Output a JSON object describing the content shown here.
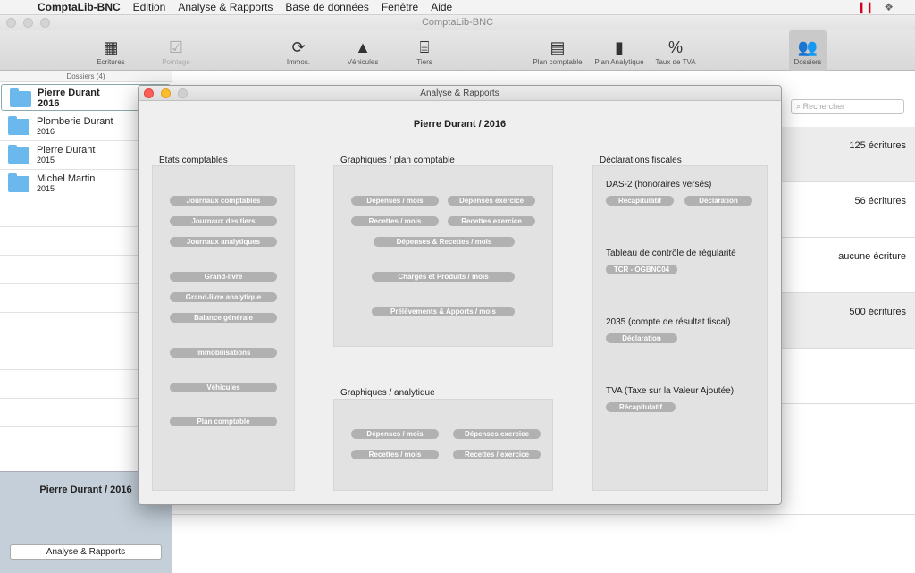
{
  "menubar": {
    "app_name": "ComptaLib-BNC",
    "items": [
      "Edition",
      "Analyse & Rapports",
      "Base de données",
      "Fenêtre",
      "Aide"
    ]
  },
  "window": {
    "title": "ComptaLib-BNC"
  },
  "toolbar": {
    "items": [
      {
        "label": "Ecritures",
        "icon": "calendar-icon"
      },
      {
        "label": "Pointage",
        "icon": "checkbox-icon"
      },
      {
        "label": "Immos.",
        "icon": "refresh-icon"
      },
      {
        "label": "Véhicules",
        "icon": "road-icon"
      },
      {
        "label": "Tiers",
        "icon": "inbox-icon"
      },
      {
        "label": "Plan comptable",
        "icon": "cabinet-icon"
      },
      {
        "label": "Plan Analytique",
        "icon": "book-icon"
      },
      {
        "label": "Taux de TVA",
        "icon": "percent-icon"
      },
      {
        "label": "Dossiers",
        "icon": "users-icon"
      }
    ]
  },
  "sidebar": {
    "header": "Dossiers (4)",
    "folders": [
      {
        "name": "Pierre Durant",
        "year": "2016"
      },
      {
        "name": "Plomberie Durant",
        "year": "2016"
      },
      {
        "name": "Pierre Durant",
        "year": "2015"
      },
      {
        "name": "Michel Martin",
        "year": "2015"
      }
    ],
    "bottom_title": "Pierre Durant / 2016",
    "bottom_button": "Analyse & Rapports"
  },
  "content": {
    "search_placeholder": "Rechercher",
    "rows": [
      "125 écritures",
      "56 écritures",
      "aucune écriture",
      "500 écritures"
    ]
  },
  "dialog": {
    "title": "Analyse & Rapports",
    "heading": "Pierre Durant / 2016",
    "etats": {
      "title": "Etats comptables",
      "buttons": [
        "Journaux comptables",
        "Journaux des tiers",
        "Journaux analytiques",
        "Grand-livre",
        "Grand-livre analytique",
        "Balance générale",
        "Immobilisations",
        "Véhicules",
        "Plan comptable"
      ]
    },
    "graph_plan": {
      "title": "Graphiques / plan comptable",
      "buttons": [
        "Dépenses / mois",
        "Dépenses exercice",
        "Recettes / mois",
        "Recettes exercice",
        "Dépenses & Recettes / mois",
        "Charges et Produits / mois",
        "Prélèvements & Apports / mois"
      ]
    },
    "graph_analytique": {
      "title": "Graphiques / analytique",
      "buttons": [
        "Dépenses / mois",
        "Dépenses exercice",
        "Recettes / mois",
        "Recettes / exercice"
      ]
    },
    "fiscal": {
      "title": "Déclarations fiscales",
      "das2": {
        "label": "DAS-2 (honoraires versés)",
        "buttons": [
          "Récapitulatif",
          "Déclaration"
        ]
      },
      "tcr": {
        "label": "Tableau de contrôle de régularité",
        "buttons": [
          "TCR - OGBNC04"
        ]
      },
      "r2035": {
        "label": "2035 (compte de résultat fiscal)",
        "buttons": [
          "Déclaration"
        ]
      },
      "tva": {
        "label": "TVA (Taxe sur la Valeur Ajoutée)",
        "buttons": [
          "Récapitulatif"
        ]
      }
    }
  }
}
